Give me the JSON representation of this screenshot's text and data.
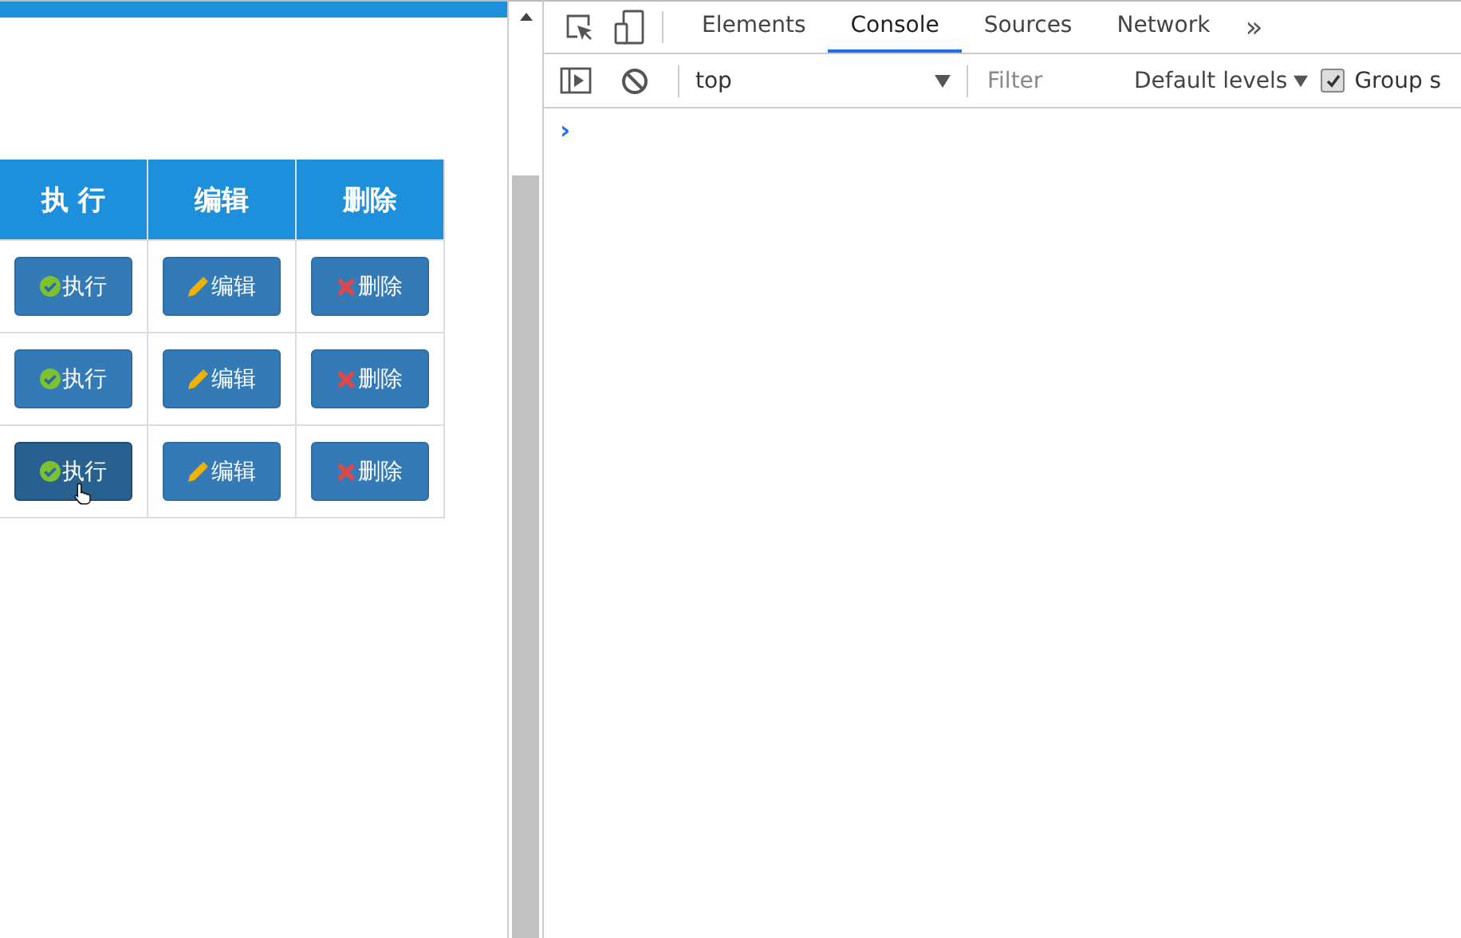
{
  "table": {
    "columns": [
      "执 行",
      "编辑",
      "删除"
    ],
    "rows": [
      {
        "buttons": [
          {
            "kind": "execute",
            "label": "执行",
            "hovered": false
          },
          {
            "kind": "edit",
            "label": "编辑",
            "hovered": false
          },
          {
            "kind": "delete",
            "label": "删除",
            "hovered": false
          }
        ]
      },
      {
        "buttons": [
          {
            "kind": "execute",
            "label": "执行",
            "hovered": false
          },
          {
            "kind": "edit",
            "label": "编辑",
            "hovered": false
          },
          {
            "kind": "delete",
            "label": "删除",
            "hovered": false
          }
        ]
      },
      {
        "buttons": [
          {
            "kind": "execute",
            "label": "执行",
            "hovered": true
          },
          {
            "kind": "edit",
            "label": "编辑",
            "hovered": false
          },
          {
            "kind": "delete",
            "label": "删除",
            "hovered": false
          }
        ]
      }
    ]
  },
  "devtools": {
    "tabs": [
      {
        "label": "Elements",
        "selected": false
      },
      {
        "label": "Console",
        "selected": true
      },
      {
        "label": "Sources",
        "selected": false
      },
      {
        "label": "Network",
        "selected": false
      }
    ],
    "more_tabs": "»",
    "context": "top",
    "filter_placeholder": "Filter",
    "levels": "Default levels",
    "group_similar": {
      "label": "Group s",
      "checked": true
    },
    "prompt": "›"
  }
}
